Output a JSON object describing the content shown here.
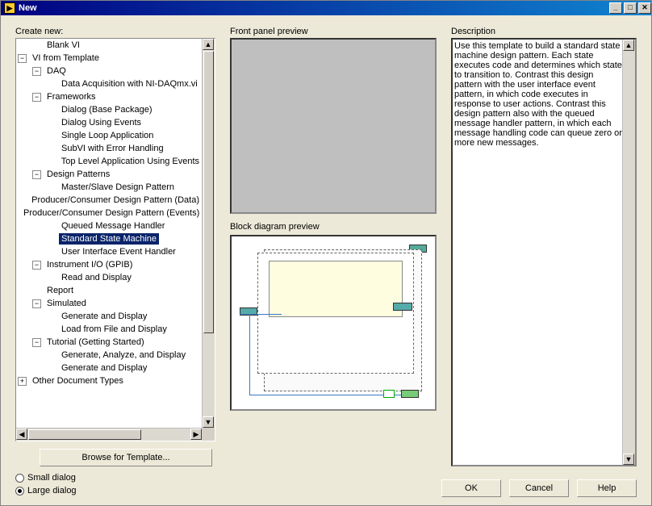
{
  "window": {
    "title": "New"
  },
  "labels": {
    "create_new": "Create new:",
    "front_preview": "Front panel preview",
    "block_preview": "Block diagram preview",
    "description": "Description"
  },
  "tree": {
    "items": [
      {
        "depth": 1,
        "twisty": "",
        "label": "Blank VI",
        "selected": false
      },
      {
        "depth": 0,
        "twisty": "−",
        "label": "VI from Template",
        "selected": false
      },
      {
        "depth": 1,
        "twisty": "−",
        "label": "DAQ",
        "selected": false
      },
      {
        "depth": 2,
        "twisty": "",
        "label": "Data Acquisition with NI-DAQmx.vi",
        "selected": false
      },
      {
        "depth": 1,
        "twisty": "−",
        "label": "Frameworks",
        "selected": false
      },
      {
        "depth": 2,
        "twisty": "",
        "label": "Dialog (Base Package)",
        "selected": false
      },
      {
        "depth": 2,
        "twisty": "",
        "label": "Dialog Using Events",
        "selected": false
      },
      {
        "depth": 2,
        "twisty": "",
        "label": "Single Loop Application",
        "selected": false
      },
      {
        "depth": 2,
        "twisty": "",
        "label": "SubVI with Error Handling",
        "selected": false
      },
      {
        "depth": 2,
        "twisty": "",
        "label": "Top Level Application Using Events",
        "selected": false
      },
      {
        "depth": 1,
        "twisty": "−",
        "label": "Design Patterns",
        "selected": false
      },
      {
        "depth": 2,
        "twisty": "",
        "label": "Master/Slave Design Pattern",
        "selected": false
      },
      {
        "depth": 2,
        "twisty": "",
        "label": "Producer/Consumer Design Pattern (Data)",
        "selected": false
      },
      {
        "depth": 2,
        "twisty": "",
        "label": "Producer/Consumer Design Pattern (Events)",
        "selected": false
      },
      {
        "depth": 2,
        "twisty": "",
        "label": "Queued Message Handler",
        "selected": false
      },
      {
        "depth": 2,
        "twisty": "",
        "label": "Standard State Machine",
        "selected": true
      },
      {
        "depth": 2,
        "twisty": "",
        "label": "User Interface Event Handler",
        "selected": false
      },
      {
        "depth": 1,
        "twisty": "−",
        "label": "Instrument I/O (GPIB)",
        "selected": false
      },
      {
        "depth": 2,
        "twisty": "",
        "label": "Read and Display",
        "selected": false
      },
      {
        "depth": 1,
        "twisty": "",
        "label": "Report",
        "selected": false
      },
      {
        "depth": 1,
        "twisty": "−",
        "label": "Simulated",
        "selected": false
      },
      {
        "depth": 2,
        "twisty": "",
        "label": "Generate and Display",
        "selected": false
      },
      {
        "depth": 2,
        "twisty": "",
        "label": "Load from File and Display",
        "selected": false
      },
      {
        "depth": 1,
        "twisty": "−",
        "label": "Tutorial (Getting Started)",
        "selected": false
      },
      {
        "depth": 2,
        "twisty": "",
        "label": "Generate, Analyze, and Display",
        "selected": false
      },
      {
        "depth": 2,
        "twisty": "",
        "label": "Generate and Display",
        "selected": false
      },
      {
        "depth": 0,
        "twisty": "+",
        "label": "Other Document Types",
        "selected": false
      }
    ]
  },
  "browse_button": "Browse for Template...",
  "description_text": "Use this template to build a standard state machine design pattern. Each state executes code and determines which state to transition to. Contrast this design pattern with the user interface event pattern, in which code executes in response to user actions. Contrast this design pattern also with the queued message handler pattern, in which each message handling code can queue zero or more new messages.",
  "radios": {
    "small": "Small dialog",
    "large": "Large dialog",
    "checked": "large"
  },
  "buttons": {
    "ok": "OK",
    "cancel": "Cancel",
    "help": "Help"
  },
  "winbtn": {
    "min": "_",
    "max": "□",
    "close": "✕"
  }
}
